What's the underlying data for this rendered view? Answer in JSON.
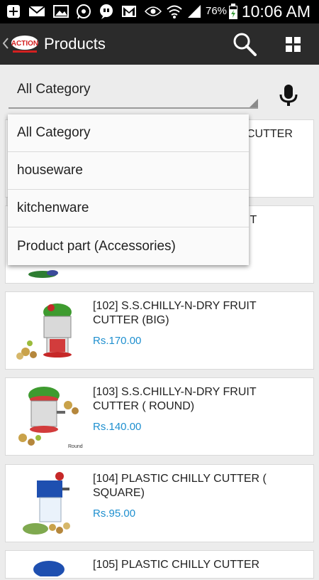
{
  "status_bar": {
    "time": "10:06 AM",
    "battery": "76%",
    "icons": [
      "add-icon",
      "mail-icon",
      "image-icon",
      "whatsapp-icon",
      "chat-icon",
      "gmail-icon",
      "eye-icon",
      "wifi-icon",
      "signal-icon",
      "battery-icon"
    ]
  },
  "app_bar": {
    "title": "Products",
    "logo_text": "ACTION",
    "back_icon": "chevron-left-icon",
    "search_icon": "search-icon",
    "grid_icon": "grid-icon"
  },
  "category": {
    "selected": "All Category",
    "mic_icon": "mic-icon"
  },
  "dropdown": {
    "options": [
      "All Category",
      "houseware",
      "kitchenware",
      "Product part (Accessories)"
    ]
  },
  "products": [
    {
      "name": "CUTTER",
      "price": ""
    },
    {
      "name": "IT",
      "price": ""
    },
    {
      "name": "[102] S.S.CHILLY-N-DRY FRUIT\nCUTTER (BIG)",
      "price": "Rs.170.00"
    },
    {
      "name": "[103] S.S.CHILLY-N-DRY FRUIT\nCUTTER ( ROUND)",
      "price": "Rs.140.00"
    },
    {
      "name": "[104] PLASTIC CHILLY CUTTER (\nSQUARE)",
      "price": "Rs.95.00"
    },
    {
      "name": "[105] PLASTIC CHILLY CUTTER",
      "price": ""
    }
  ],
  "colors": {
    "accent": "#1e8fcf",
    "app_bar": "#2b2b2b",
    "status_bar": "#000000"
  }
}
